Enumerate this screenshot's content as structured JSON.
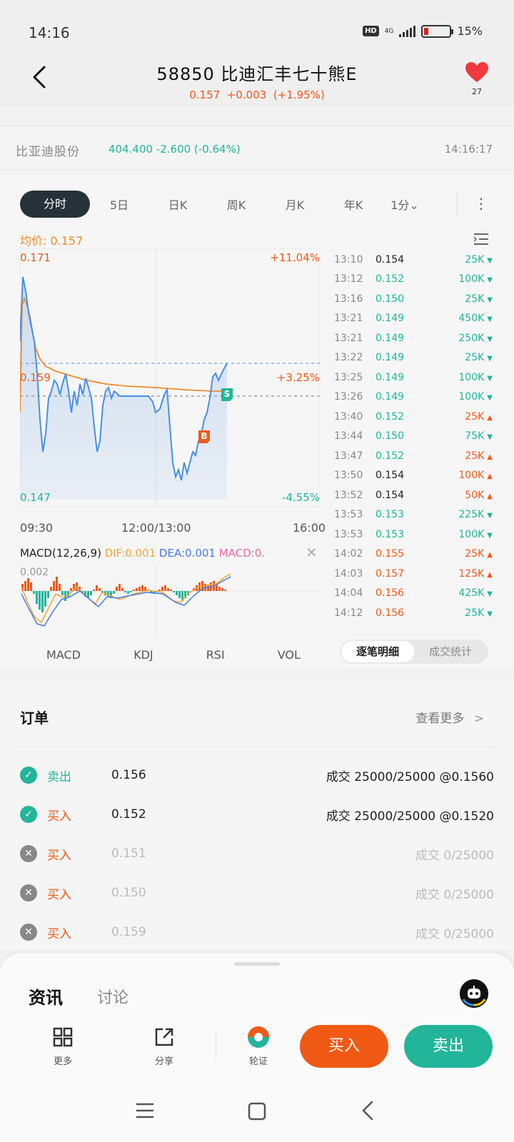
{
  "status": {
    "time": "14:16",
    "hd": "HD",
    "network": "4G",
    "battery": "15%",
    "battery_level": 0.15
  },
  "header": {
    "title": "58850 比迪汇丰七十熊E",
    "price": "0.157",
    "change": "+0.003",
    "change_pct": "(+1.95%)",
    "fav_count": "27"
  },
  "underlying": {
    "name": "比亚迪股份",
    "quote": "404.400 -2.600 (-0.64%)",
    "time": "14:16:17"
  },
  "tabs": [
    {
      "label": "分时"
    },
    {
      "label": "5日"
    },
    {
      "label": "日K"
    },
    {
      "label": "周K"
    },
    {
      "label": "月K"
    },
    {
      "label": "年K"
    },
    {
      "label": "1分⌄"
    }
  ],
  "more_menu": "⋮",
  "chart": {
    "avg_label": "均价: 0.157",
    "y_high": "0.171",
    "y_mid": "0.159",
    "y_low": "0.147",
    "pct_high": "+11.04%",
    "pct_mid": "+3.25%",
    "pct_low": "-4.55%",
    "t_start": "09:30",
    "t_mid": "12:00/13:00",
    "t_end": "16:00",
    "buy_marker": "B",
    "sell_marker": "S",
    "colors": {
      "price": "#4a90e2",
      "avg": "#f08a2e",
      "up": "#ee5a1a",
      "down": "#22b59a"
    }
  },
  "macd": {
    "name": "MACD(12,26,9)",
    "dif": "DIF:0.001",
    "dea": "DEA:0.001",
    "macd": "MACD:0.",
    "axis_top": "0.002",
    "close": "✕"
  },
  "indicator_tabs": [
    "MACD",
    "KDJ",
    "RSI",
    "VOL"
  ],
  "ticks": [
    {
      "time": "13:10",
      "price": "0.154",
      "vol": "25K",
      "dir": "down",
      "pc": "dark"
    },
    {
      "time": "13:12",
      "price": "0.152",
      "vol": "100K",
      "dir": "down",
      "pc": "down"
    },
    {
      "time": "13:16",
      "price": "0.150",
      "vol": "25K",
      "dir": "down",
      "pc": "down"
    },
    {
      "time": "13:21",
      "price": "0.149",
      "vol": "450K",
      "dir": "down",
      "pc": "down"
    },
    {
      "time": "13:21",
      "price": "0.149",
      "vol": "250K",
      "dir": "down",
      "pc": "down"
    },
    {
      "time": "13:22",
      "price": "0.149",
      "vol": "25K",
      "dir": "down",
      "pc": "down"
    },
    {
      "time": "13:25",
      "price": "0.149",
      "vol": "100K",
      "dir": "down",
      "pc": "down"
    },
    {
      "time": "13:26",
      "price": "0.149",
      "vol": "100K",
      "dir": "down",
      "pc": "down"
    },
    {
      "time": "13:40",
      "price": "0.152",
      "vol": "25K",
      "dir": "up",
      "pc": "down"
    },
    {
      "time": "13:44",
      "price": "0.150",
      "vol": "75K",
      "dir": "down",
      "pc": "down"
    },
    {
      "time": "13:47",
      "price": "0.152",
      "vol": "25K",
      "dir": "up",
      "pc": "down"
    },
    {
      "time": "13:50",
      "price": "0.154",
      "vol": "100K",
      "dir": "up",
      "pc": "dark"
    },
    {
      "time": "13:52",
      "price": "0.154",
      "vol": "50K",
      "dir": "up",
      "pc": "dark"
    },
    {
      "time": "13:53",
      "price": "0.153",
      "vol": "225K",
      "dir": "down",
      "pc": "down"
    },
    {
      "time": "13:53",
      "price": "0.153",
      "vol": "100K",
      "dir": "down",
      "pc": "down"
    },
    {
      "time": "14:02",
      "price": "0.155",
      "vol": "25K",
      "dir": "up",
      "pc": "up"
    },
    {
      "time": "14:03",
      "price": "0.157",
      "vol": "125K",
      "dir": "up",
      "pc": "up"
    },
    {
      "time": "14:04",
      "price": "0.156",
      "vol": "425K",
      "dir": "down",
      "pc": "up"
    },
    {
      "time": "14:12",
      "price": "0.156",
      "vol": "25K",
      "dir": "down",
      "pc": "up"
    }
  ],
  "tick_switch": {
    "detail": "逐笔明细",
    "stats": "成交统计"
  },
  "orders": {
    "title": "订单",
    "more": "查看更多",
    "rows": [
      {
        "status": "filled",
        "side": "卖出",
        "side_type": "sell",
        "price": "0.156",
        "deal": "成交 25000/25000 @0.1560"
      },
      {
        "status": "filled",
        "side": "买入",
        "side_type": "buy",
        "price": "0.152",
        "deal": "成交 25000/25000 @0.1520"
      },
      {
        "status": "cancelled",
        "side": "买入",
        "side_type": "buy",
        "price": "0.151",
        "deal": "成交 0/25000"
      },
      {
        "status": "cancelled",
        "side": "买入",
        "side_type": "buy",
        "price": "0.150",
        "deal": "成交 0/25000"
      },
      {
        "status": "cancelled",
        "side": "买入",
        "side_type": "buy",
        "price": "0.159",
        "deal": "成交 0/25000"
      }
    ]
  },
  "panel": {
    "news": "资讯",
    "discuss": "讨论",
    "actions": {
      "more": "更多",
      "share": "分享",
      "warrant": "轮证"
    },
    "buy": "买入",
    "sell": "卖出"
  }
}
